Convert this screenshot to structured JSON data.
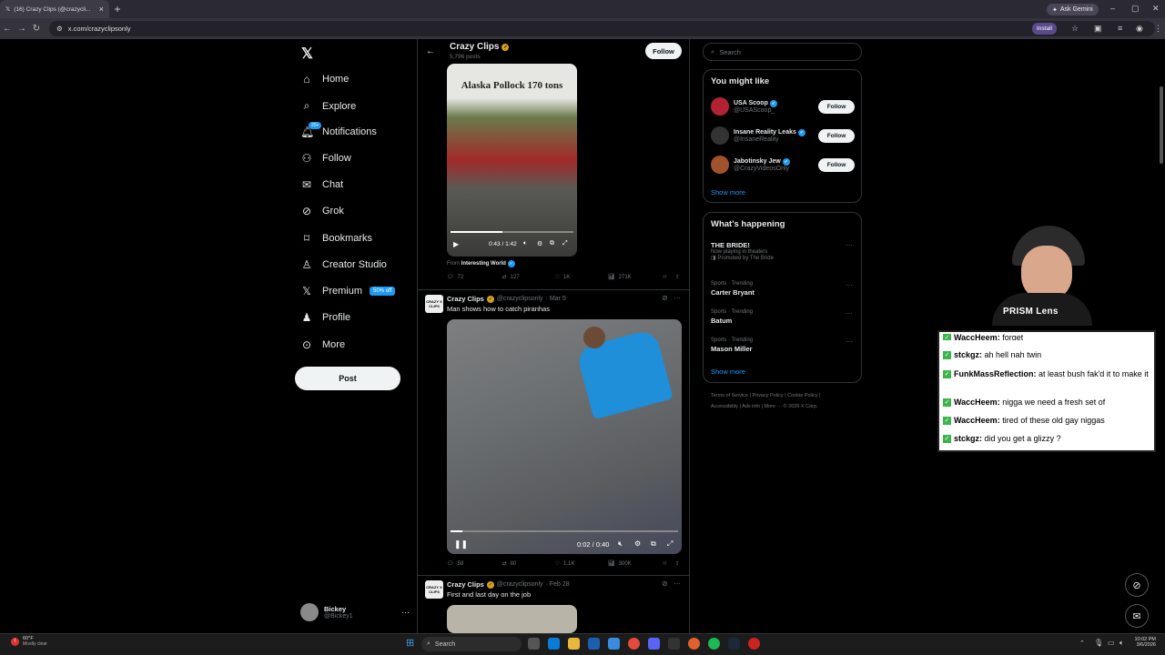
{
  "browser": {
    "tab_title": "(16) Crazy Clips (@crazycli...",
    "url": "x.com/crazyclipsonly",
    "ask_gemini": "Ask Gemini",
    "install": "Install"
  },
  "nav": {
    "home": "Home",
    "explore": "Explore",
    "notifications": "Notifications",
    "notifications_badge": "20+",
    "follow": "Follow",
    "chat": "Chat",
    "grok": "Grok",
    "bookmarks": "Bookmarks",
    "creator_studio": "Creator Studio",
    "premium": "Premium",
    "premium_badge": "50% off",
    "profile": "Profile",
    "more": "More",
    "post": "Post"
  },
  "account": {
    "name": "Bickey",
    "handle": "@Bickey1"
  },
  "profile_header": {
    "name": "Crazy Clips",
    "posts": "5,796 posts",
    "follow": "Follow"
  },
  "tweet1": {
    "overlay_text": "Alaska Pollock 170 tons",
    "time": "0:43 / 1:42",
    "from_label": "From",
    "from_source": "Interesting World",
    "replies": "72",
    "reposts": "127",
    "likes": "1K",
    "views": "271K"
  },
  "tweet2": {
    "name": "Crazy Clips",
    "handle": "@crazyclipsonly",
    "date": "· Mar 5",
    "text": "Man shows how to catch piranhas",
    "time": "0:02 / 0:40",
    "replies": "58",
    "reposts": "80",
    "likes": "1.1K",
    "views": "300K",
    "avatar_text": "CRAZY X CLIPS"
  },
  "tweet3": {
    "name": "Crazy Clips",
    "handle": "@crazyclipsonly",
    "date": "· Feb 28",
    "text": "First and last day on the job",
    "avatar_text": "CRAZY X CLIPS"
  },
  "search": {
    "placeholder": "Search"
  },
  "you_might_like": {
    "title": "You might like",
    "items": [
      {
        "name": "USA Scoop",
        "handle": "@USAScoop_",
        "button": "Follow"
      },
      {
        "name": "Insane Reality Leaks",
        "handle": "@InsaneReality",
        "button": "Follow"
      },
      {
        "name": "Jabotinsky Jew",
        "handle": "@CrazyVideosOnly",
        "button": "Follow"
      }
    ],
    "show_more": "Show more"
  },
  "whats_happening": {
    "title": "What's happening",
    "items": [
      {
        "meta": "",
        "title": "THE BRIDE!",
        "sub": "Now playing in theaters",
        "promo": "Promoted by The Bride"
      },
      {
        "meta": "Sports · Trending",
        "title": "Carter Bryant"
      },
      {
        "meta": "Sports · Trending",
        "title": "Batum"
      },
      {
        "meta": "Sports · Trending",
        "title": "Mason Miller"
      }
    ],
    "show_more": "Show more"
  },
  "footer": {
    "line1": "Terms of Service  |  Privacy Policy  |  Cookie Policy  |",
    "line2": "Accessibility  |  Ads info  |  More ···  © 2026 X Corp."
  },
  "stream": {
    "cam_label": "PRISM Lens",
    "chat": [
      {
        "user": "WaccHeem:",
        "msg": "forget"
      },
      {
        "user": "stckgz:",
        "msg": "ah hell nah twin"
      },
      {
        "user": "FunkMassReflection:",
        "msg": "at least bush fak'd it to make it"
      },
      {
        "user": "WaccHeem:",
        "msg": "nigga we need a fresh set of"
      },
      {
        "user": "WaccHeem:",
        "msg": "tired of these old gay niggas"
      },
      {
        "user": "stckgz:",
        "msg": "did you get a glizzy ?"
      }
    ]
  },
  "taskbar": {
    "weather_temp": "60°F",
    "weather_desc": "Mostly clear",
    "search": "Search",
    "time": "10:02 PM",
    "date": "3/6/2026"
  },
  "colors": {
    "accent": "#1d9bf0",
    "gold_check": "#d4a017",
    "bg": "#000000"
  }
}
